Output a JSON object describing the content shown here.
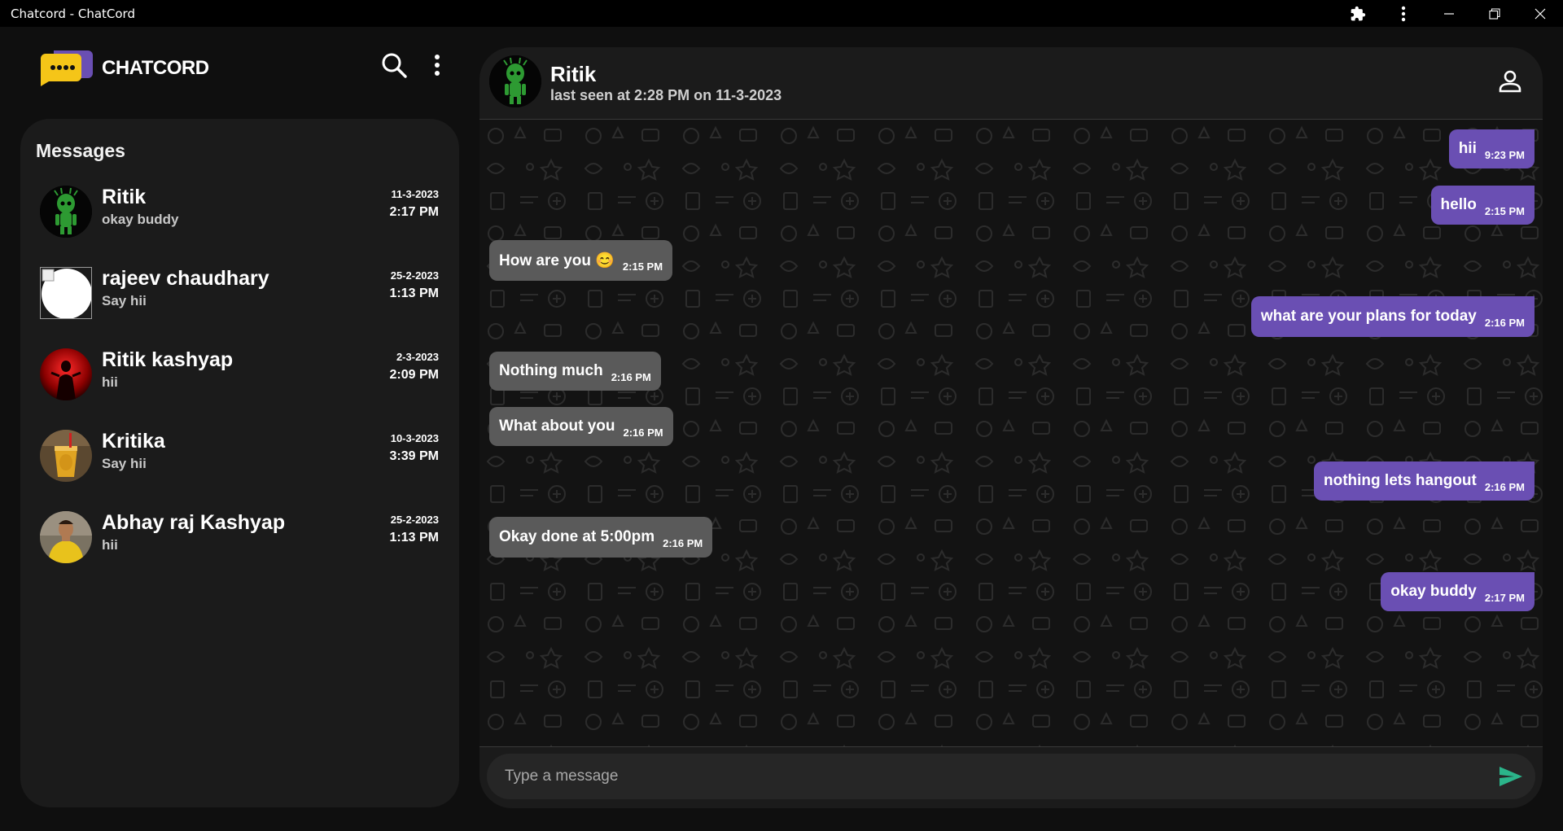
{
  "window": {
    "title": "Chatcord - ChatCord",
    "buttons": [
      "extensions-icon",
      "more-vert-icon",
      "minimize-icon",
      "restore-icon",
      "close-icon"
    ]
  },
  "app": {
    "brand": "CHATCORD",
    "accent_color": "#6a4fb3",
    "logo_color": "#f5c518"
  },
  "sidebar": {
    "title": "Messages",
    "conversations": [
      {
        "name": "Ritik",
        "last": "okay buddy",
        "date": "11-3-2023",
        "time": "2:17 PM",
        "avatar": "groot"
      },
      {
        "name": "rajeev chaudhary",
        "last": "Say hii",
        "date": "25-2-2023",
        "time": "1:13 PM",
        "avatar": "broken-image"
      },
      {
        "name": "Ritik kashyap",
        "last": "hii",
        "date": "2-3-2023",
        "time": "2:09 PM",
        "avatar": "red-figure"
      },
      {
        "name": "Kritika",
        "last": "Say hii",
        "date": "10-3-2023",
        "time": "3:39 PM",
        "avatar": "drink"
      },
      {
        "name": "Abhay raj Kashyap",
        "last": "hii",
        "date": "25-2-2023",
        "time": "1:13 PM",
        "avatar": "person-yellow"
      }
    ]
  },
  "chat": {
    "contact_name": "Ritik",
    "last_seen": "last seen at 2:28 PM on 11-3-2023",
    "messages": [
      {
        "dir": "out",
        "text": "hii",
        "time": "9:23 PM"
      },
      {
        "dir": "out",
        "text": "hello",
        "time": "2:15 PM"
      },
      {
        "dir": "in",
        "text": "How are you 😊",
        "time": "2:15 PM"
      },
      {
        "dir": "out",
        "text": "what are your plans for today",
        "time": "2:16 PM"
      },
      {
        "dir": "in",
        "text": "Nothing much",
        "time": "2:16 PM"
      },
      {
        "dir": "in",
        "text": "What about you",
        "time": "2:16 PM"
      },
      {
        "dir": "out",
        "text": "nothing lets hangout",
        "time": "2:16 PM"
      },
      {
        "dir": "in",
        "text": "Okay done at 5:00pm",
        "time": "2:16 PM"
      },
      {
        "dir": "out",
        "text": "okay buddy",
        "time": "2:17 PM"
      }
    ],
    "composer": {
      "placeholder": "Type a message",
      "value": ""
    },
    "send_color": "#2bb48a"
  }
}
